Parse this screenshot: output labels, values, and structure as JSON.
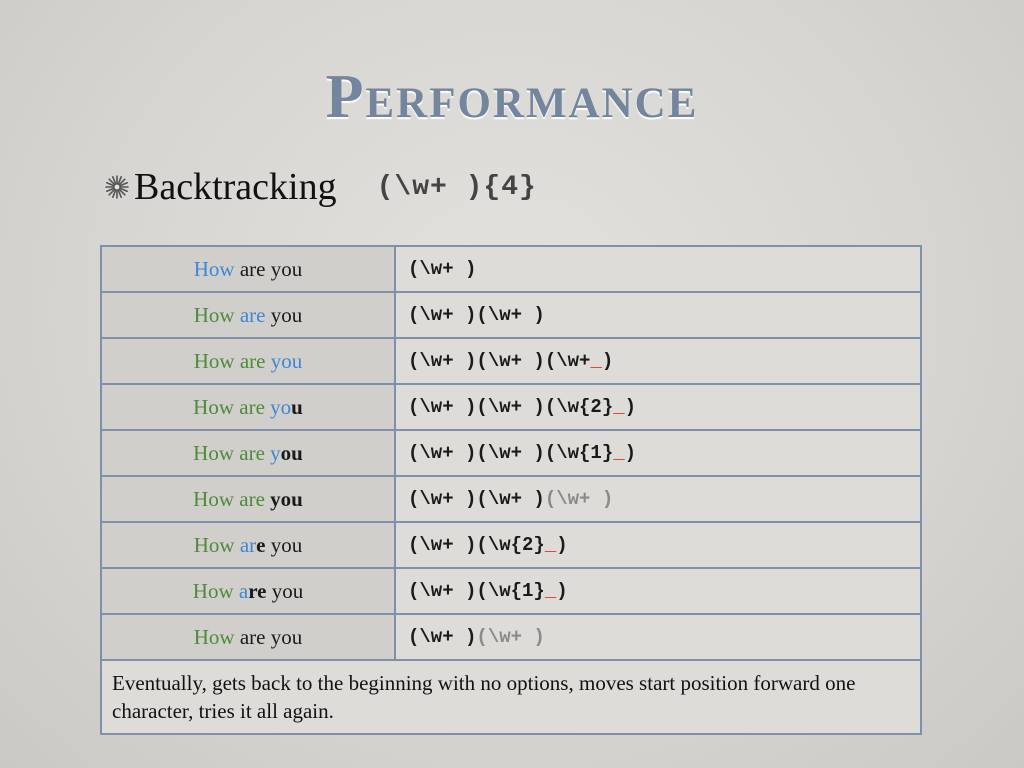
{
  "slide": {
    "title": "Performance",
    "bullet": {
      "icon": "asterisk-flower-icon",
      "text": "Backtracking",
      "regex": "(\\w+ ){4}"
    }
  },
  "table": {
    "rows": [
      {
        "phrase": [
          {
            "text": "How",
            "style": "blue"
          },
          {
            "text": " are you",
            "style": "blk"
          }
        ],
        "pattern": [
          {
            "text": "(\\w+ )",
            "style": "blk"
          }
        ]
      },
      {
        "phrase": [
          {
            "text": "How ",
            "style": "green"
          },
          {
            "text": "are",
            "style": "blue"
          },
          {
            "text": " you",
            "style": "blk"
          }
        ],
        "pattern": [
          {
            "text": "(\\w+ )(\\w+ )",
            "style": "blk"
          }
        ]
      },
      {
        "phrase": [
          {
            "text": "How are ",
            "style": "green"
          },
          {
            "text": "you",
            "style": "blue"
          }
        ],
        "pattern": [
          {
            "text": "(\\w+ )(\\w+ )(\\w+",
            "style": "blk"
          },
          {
            "text": "_",
            "style": "red"
          },
          {
            "text": ")",
            "style": "blk"
          }
        ]
      },
      {
        "phrase": [
          {
            "text": "How are ",
            "style": "green"
          },
          {
            "text": "yo",
            "style": "blue"
          },
          {
            "text": "u",
            "style": "bold"
          }
        ],
        "pattern": [
          {
            "text": "(\\w+ )(\\w+ )(\\w{2}",
            "style": "blk"
          },
          {
            "text": "_",
            "style": "red"
          },
          {
            "text": ")",
            "style": "blk"
          }
        ]
      },
      {
        "phrase": [
          {
            "text": "How are ",
            "style": "green"
          },
          {
            "text": "y",
            "style": "blue"
          },
          {
            "text": "ou",
            "style": "bold"
          }
        ],
        "pattern": [
          {
            "text": "(\\w+ )(\\w+ )(\\w{1}",
            "style": "blk"
          },
          {
            "text": "_",
            "style": "red"
          },
          {
            "text": ")",
            "style": "blk"
          }
        ]
      },
      {
        "phrase": [
          {
            "text": "How are ",
            "style": "green"
          },
          {
            "text": "you",
            "style": "bold"
          }
        ],
        "pattern": [
          {
            "text": "(\\w+ )(\\w+ )",
            "style": "blk"
          },
          {
            "text": "(\\w+ )",
            "style": "gray"
          }
        ]
      },
      {
        "phrase": [
          {
            "text": "How ",
            "style": "green"
          },
          {
            "text": "ar",
            "style": "blue"
          },
          {
            "text": "e",
            "style": "bold"
          },
          {
            "text": " you",
            "style": "blk"
          }
        ],
        "pattern": [
          {
            "text": "(\\w+ )(\\w{2}",
            "style": "blk"
          },
          {
            "text": "_",
            "style": "red"
          },
          {
            "text": ")",
            "style": "blk"
          }
        ]
      },
      {
        "phrase": [
          {
            "text": "How ",
            "style": "green"
          },
          {
            "text": "a",
            "style": "blue"
          },
          {
            "text": "re",
            "style": "bold"
          },
          {
            "text": " you",
            "style": "blk"
          }
        ],
        "pattern": [
          {
            "text": "(\\w+ )(\\w{1}",
            "style": "blk"
          },
          {
            "text": "_",
            "style": "red"
          },
          {
            "text": ")",
            "style": "blk"
          }
        ]
      },
      {
        "phrase": [
          {
            "text": "How",
            "style": "green"
          },
          {
            "text": " are you",
            "style": "blk"
          }
        ],
        "pattern": [
          {
            "text": "(\\w+ )",
            "style": "blk"
          },
          {
            "text": "(\\w+ )",
            "style": "gray"
          }
        ]
      }
    ],
    "footer": "Eventually, gets back to the beginning with no options, moves start position forward one character, tries it all again."
  },
  "colors": {
    "title": "#74869e",
    "matched_green": "#4f8a3a",
    "current_blue": "#3f86d6",
    "space_red": "#e0401c",
    "unmatched_gray": "#8a8a8a",
    "border": "#7f90a8"
  }
}
